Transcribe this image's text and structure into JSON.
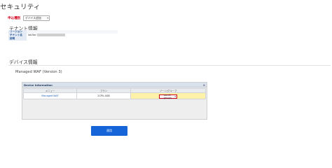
{
  "page": {
    "title": "セキュリティ"
  },
  "application": {
    "label": "申込種別",
    "selected": "デバイス追加"
  },
  "tenant": {
    "heading": "テナント情報",
    "rows": [
      {
        "key": "リージョン",
        "value": ""
      },
      {
        "key": "テナント名",
        "value": "lab3ec"
      },
      {
        "key": "説明",
        "value": ""
      }
    ]
  },
  "device": {
    "heading": "デバイス情報",
    "subheading": "Managed WAF (Version 3)",
    "panel": {
      "title": "Device Information",
      "columns": [
        "メニュー",
        "プラン",
        "ゾーン/グループ"
      ],
      "rows": [
        {
          "menu": "Managed WAF",
          "plan": "2CPU-4GB",
          "zone": "zone1-groupa"
        }
      ]
    }
  },
  "actions": {
    "apply_label": "適用"
  },
  "icons": {
    "select_chevron": "chevron-down-icon",
    "panel_close": "close-icon"
  },
  "colors": {
    "required_label": "#d0021b",
    "highlight_border": "#d0021b",
    "primary_button": "#1565d8",
    "zone_bg": "#fdf2a8"
  }
}
